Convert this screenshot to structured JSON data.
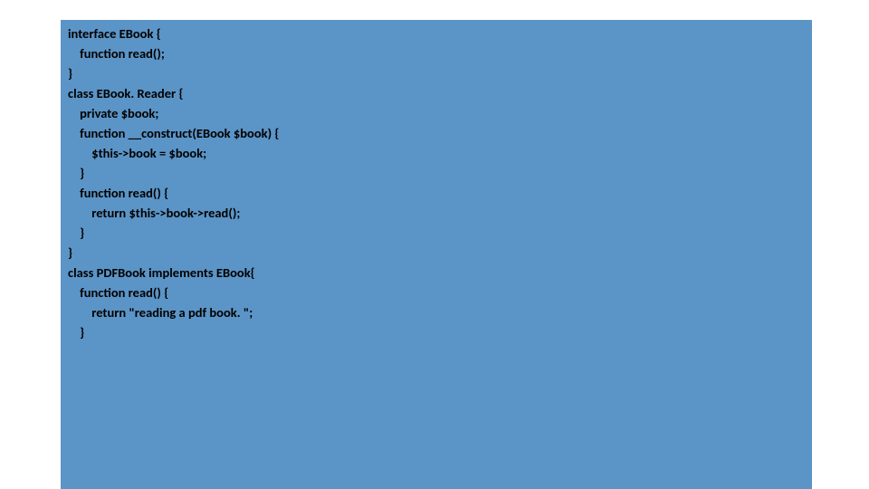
{
  "code": {
    "lines": [
      "interface EBook {",
      "    function read();",
      "}",
      "",
      "class EBook. Reader {",
      "",
      "    private $book;",
      "",
      "    function __construct(EBook $book) {",
      "        $this->book = $book;",
      "    }",
      "",
      "    function read() {",
      "        return $this->book->read();",
      "    }",
      "",
      "}",
      "",
      "class PDFBook implements EBook{",
      "",
      "    function read() {",
      "        return \"reading a pdf book. \";",
      "    }"
    ]
  }
}
